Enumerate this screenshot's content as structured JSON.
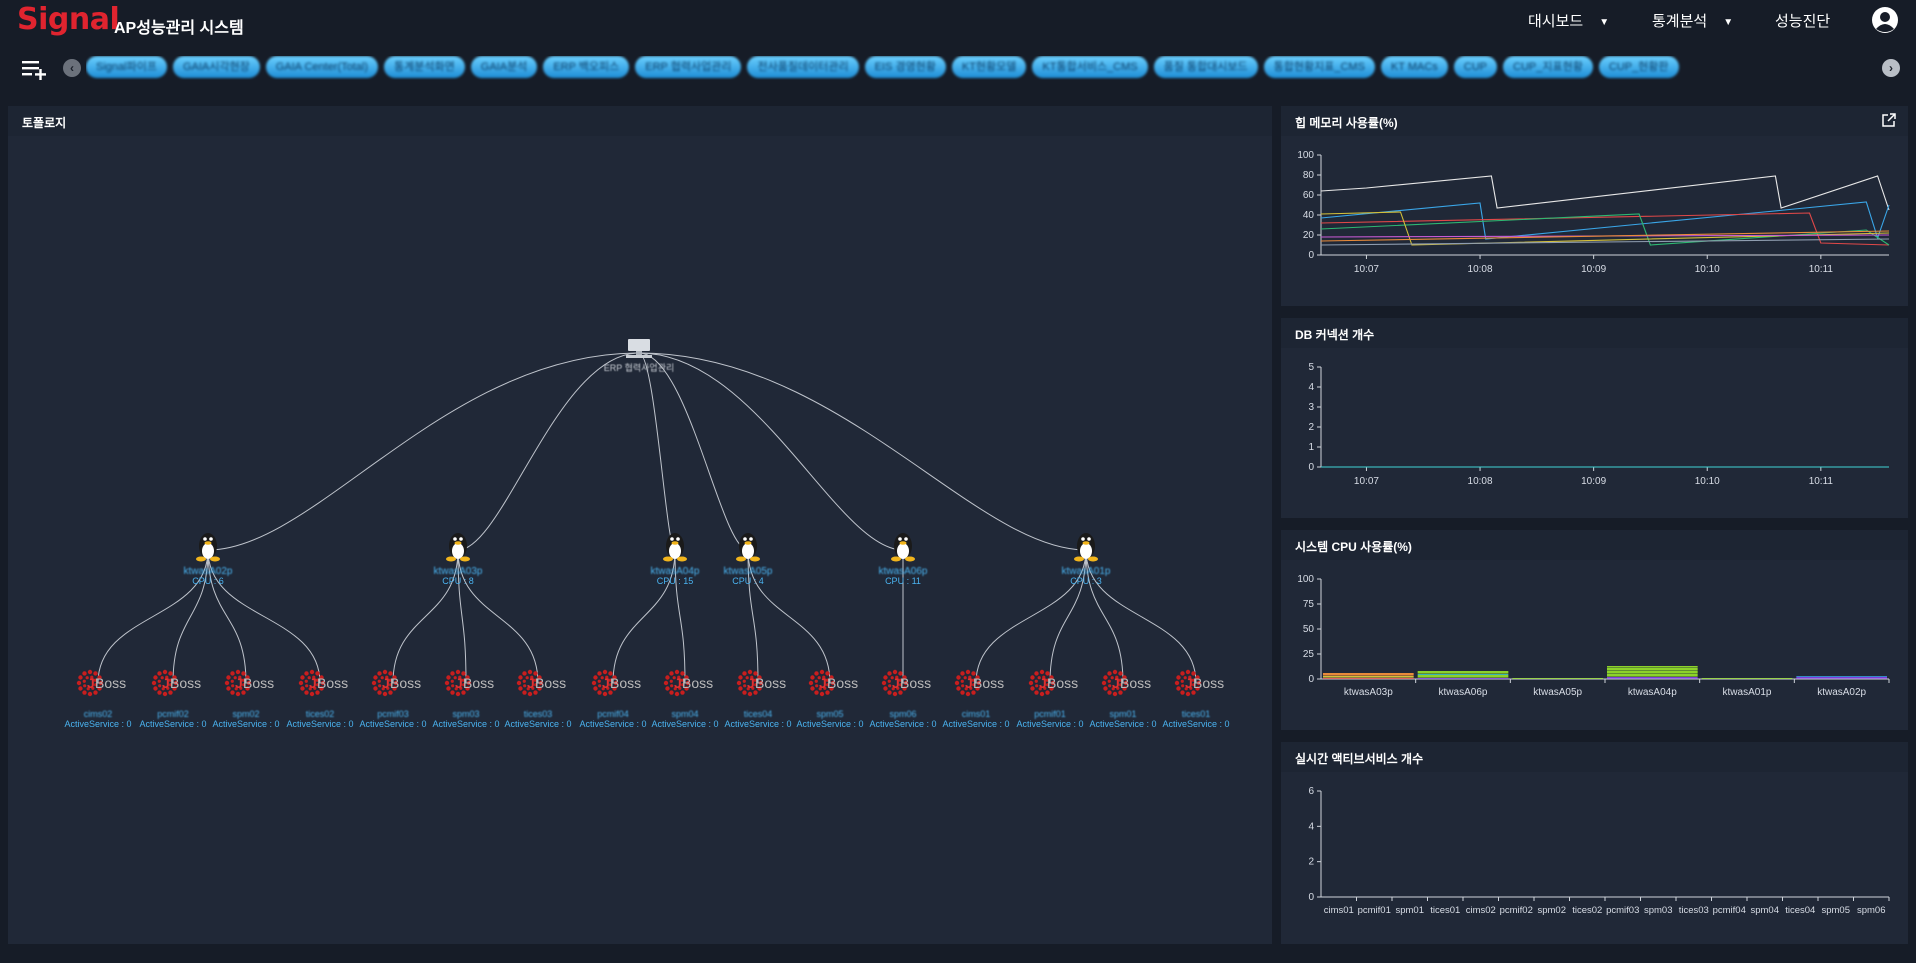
{
  "app": {
    "logo": "Signal",
    "title": "AP성능관리 시스템"
  },
  "nav": [
    {
      "label": "대시보드",
      "has_caret": true
    },
    {
      "label": "통계분석",
      "has_caret": true
    },
    {
      "label": "성능진단",
      "has_caret": false
    }
  ],
  "tabs": [
    "Signal파이프",
    "GAIA시각현장",
    "GAIA Center(Total)",
    "통계분석화면",
    "GAIA분석",
    "ERP 백오피스",
    "ERP 협력사업관리",
    "전사품질데이터관리",
    "EIS 경영현황",
    "KT현황모델",
    "KT통합서비스_CMS",
    "품질 통합대시보드",
    "통합현황지표_CMS",
    "KT MACs",
    "CUP",
    "CUP_지표현황",
    "CUP_현황판"
  ],
  "colors": {
    "accent_red": "#e0242f",
    "chart_cpu_bar_green": "#8cd22a",
    "chart_cpu_bar_purple": "#7a3bdc",
    "chart_line_cyan": "#3fd4d4",
    "linux_label": "#4ab3f0",
    "jboss_red": "#c81e1e"
  },
  "topology": {
    "title": "토폴로지",
    "root_label": "ERP 협력사업관리",
    "hosts": [
      {
        "name": "ktwasA02p",
        "cpu": "CPU : 6"
      },
      {
        "name": "ktwasA03p",
        "cpu": "CPU : 8"
      },
      {
        "name": "ktwasA04p",
        "cpu": "CPU : 15"
      },
      {
        "name": "ktwasA05p",
        "cpu": "CPU : 4"
      },
      {
        "name": "ktwasA06p",
        "cpu": "CPU : 11"
      },
      {
        "name": "ktwasA01p",
        "cpu": "CPU : 3"
      }
    ],
    "was": [
      {
        "name": "cims02",
        "host": 0,
        "active": "ActiveService : 0"
      },
      {
        "name": "pcmif02",
        "host": 0,
        "active": "ActiveService : 0"
      },
      {
        "name": "spm02",
        "host": 0,
        "active": "ActiveService : 0"
      },
      {
        "name": "tices02",
        "host": 0,
        "active": "ActiveService : 0"
      },
      {
        "name": "pcmif03",
        "host": 1,
        "active": "ActiveService : 0"
      },
      {
        "name": "spm03",
        "host": 1,
        "active": "ActiveService : 0"
      },
      {
        "name": "tices03",
        "host": 1,
        "active": "ActiveService : 0"
      },
      {
        "name": "pcmif04",
        "host": 2,
        "active": "ActiveService : 0"
      },
      {
        "name": "spm04",
        "host": 2,
        "active": "ActiveService : 0"
      },
      {
        "name": "tices04",
        "host": 3,
        "active": "ActiveService : 0"
      },
      {
        "name": "spm05",
        "host": 3,
        "active": "ActiveService : 0"
      },
      {
        "name": "spm06",
        "host": 4,
        "active": "ActiveService : 0"
      },
      {
        "name": "cims01",
        "host": 5,
        "active": "ActiveService : 0"
      },
      {
        "name": "pcmif01",
        "host": 5,
        "active": "ActiveService : 0"
      },
      {
        "name": "spm01",
        "host": 5,
        "active": "ActiveService : 0"
      },
      {
        "name": "tices01",
        "host": 5,
        "active": "ActiveService : 0"
      }
    ]
  },
  "chart_data": [
    {
      "type": "line",
      "title": "힙 메모리 사용률(%)",
      "ylim": [
        0,
        100
      ],
      "yticks": [
        0,
        20,
        40,
        60,
        80,
        100
      ],
      "x_ticks": [
        "10:07",
        "10:08",
        "10:09",
        "10:10",
        "10:11"
      ],
      "x_range": [
        10.6,
        15.6
      ],
      "grid": false,
      "series": [
        {
          "color": "#e8e8e8",
          "x": [
            10.6,
            11.0,
            12.1,
            12.15,
            14.6,
            14.65,
            15.5,
            15.6
          ],
          "y": [
            64,
            67,
            79,
            47,
            79,
            47,
            79,
            45
          ]
        },
        {
          "color": "#3aa6e8",
          "x": [
            10.6,
            12.0,
            12.05,
            14.5,
            15.4,
            15.5,
            15.6
          ],
          "y": [
            37,
            52,
            16,
            43,
            53,
            17,
            50
          ]
        },
        {
          "color": "#e04848",
          "x": [
            10.6,
            14.9,
            15.0,
            15.6
          ],
          "y": [
            32,
            42,
            12,
            10
          ]
        },
        {
          "color": "#2eb872",
          "x": [
            10.6,
            13.4,
            13.5,
            15.4,
            15.6
          ],
          "y": [
            26,
            41,
            10,
            25,
            10
          ]
        },
        {
          "color": "#d4c03a",
          "x": [
            10.6,
            11.3,
            11.4,
            15.6
          ],
          "y": [
            41,
            43,
            10,
            22
          ]
        },
        {
          "color": "#c85ad4",
          "x": [
            10.6,
            15.6
          ],
          "y": [
            18,
            20
          ]
        },
        {
          "color": "#e88a3a",
          "x": [
            10.6,
            15.6
          ],
          "y": [
            14,
            24
          ]
        },
        {
          "color": "#8f9db0",
          "x": [
            10.6,
            15.6
          ],
          "y": [
            10,
            16
          ]
        }
      ]
    },
    {
      "type": "line",
      "title": "DB 커넥션 개수",
      "ylim": [
        0,
        5
      ],
      "yticks": [
        0,
        1,
        2,
        3,
        4,
        5
      ],
      "x_ticks": [
        "10:07",
        "10:08",
        "10:09",
        "10:10",
        "10:11"
      ],
      "x_range": [
        10.6,
        15.6
      ],
      "grid": false,
      "series": [
        {
          "color": "#3fd4d4",
          "x": [
            10.6,
            15.6
          ],
          "y": [
            0,
            0
          ]
        }
      ]
    },
    {
      "type": "bar",
      "title": "시스템 CPU 사용률(%)",
      "ylim": [
        0,
        100
      ],
      "yticks": [
        0,
        25,
        50,
        75,
        100
      ],
      "categories": [
        "ktwasA03p",
        "ktwasA06p",
        "ktwasA05p",
        "ktwasA04p",
        "ktwasA01p",
        "ktwasA02p"
      ],
      "stacks": [
        [
          {
            "color": "#e04848",
            "v": 1
          },
          {
            "color": "#d4c03a",
            "v": 2
          },
          {
            "color": "#e88a3a",
            "v": 3
          }
        ],
        [
          {
            "color": "#7a3bdc",
            "v": 1
          },
          {
            "color": "#8cd22a",
            "v": 3
          },
          {
            "color": "#3fd4d4",
            "v": 1
          },
          {
            "color": "#8cd22a",
            "v": 3
          }
        ],
        [
          {
            "color": "#8cd22a",
            "v": 1
          }
        ],
        [
          {
            "color": "#7a3bdc",
            "v": 2
          },
          {
            "color": "#8cd22a",
            "v": 3
          },
          {
            "color": "#8cd22a",
            "v": 3
          },
          {
            "color": "#8cd22a",
            "v": 3
          },
          {
            "color": "#8cd22a",
            "v": 2
          }
        ],
        [
          {
            "color": "#8cd22a",
            "v": 1
          }
        ],
        [
          {
            "color": "#7a3bdc",
            "v": 2
          },
          {
            "color": "#3aa6e8",
            "v": 1
          }
        ]
      ]
    },
    {
      "type": "bar",
      "title": "실시간 액티브서비스 개수",
      "ylim": [
        0,
        6
      ],
      "yticks": [
        0,
        2,
        4,
        6
      ],
      "categories": [
        "cims01",
        "pcmif01",
        "spm01",
        "tices01",
        "cims02",
        "pcmif02",
        "spm02",
        "tices02",
        "pcmif03",
        "spm03",
        "tices03",
        "pcmif04",
        "spm04",
        "tices04",
        "spm05",
        "spm06"
      ],
      "values": [
        0,
        0,
        0,
        0,
        0,
        0,
        0,
        0,
        0,
        0,
        0,
        0,
        0,
        0,
        0,
        0
      ]
    }
  ]
}
